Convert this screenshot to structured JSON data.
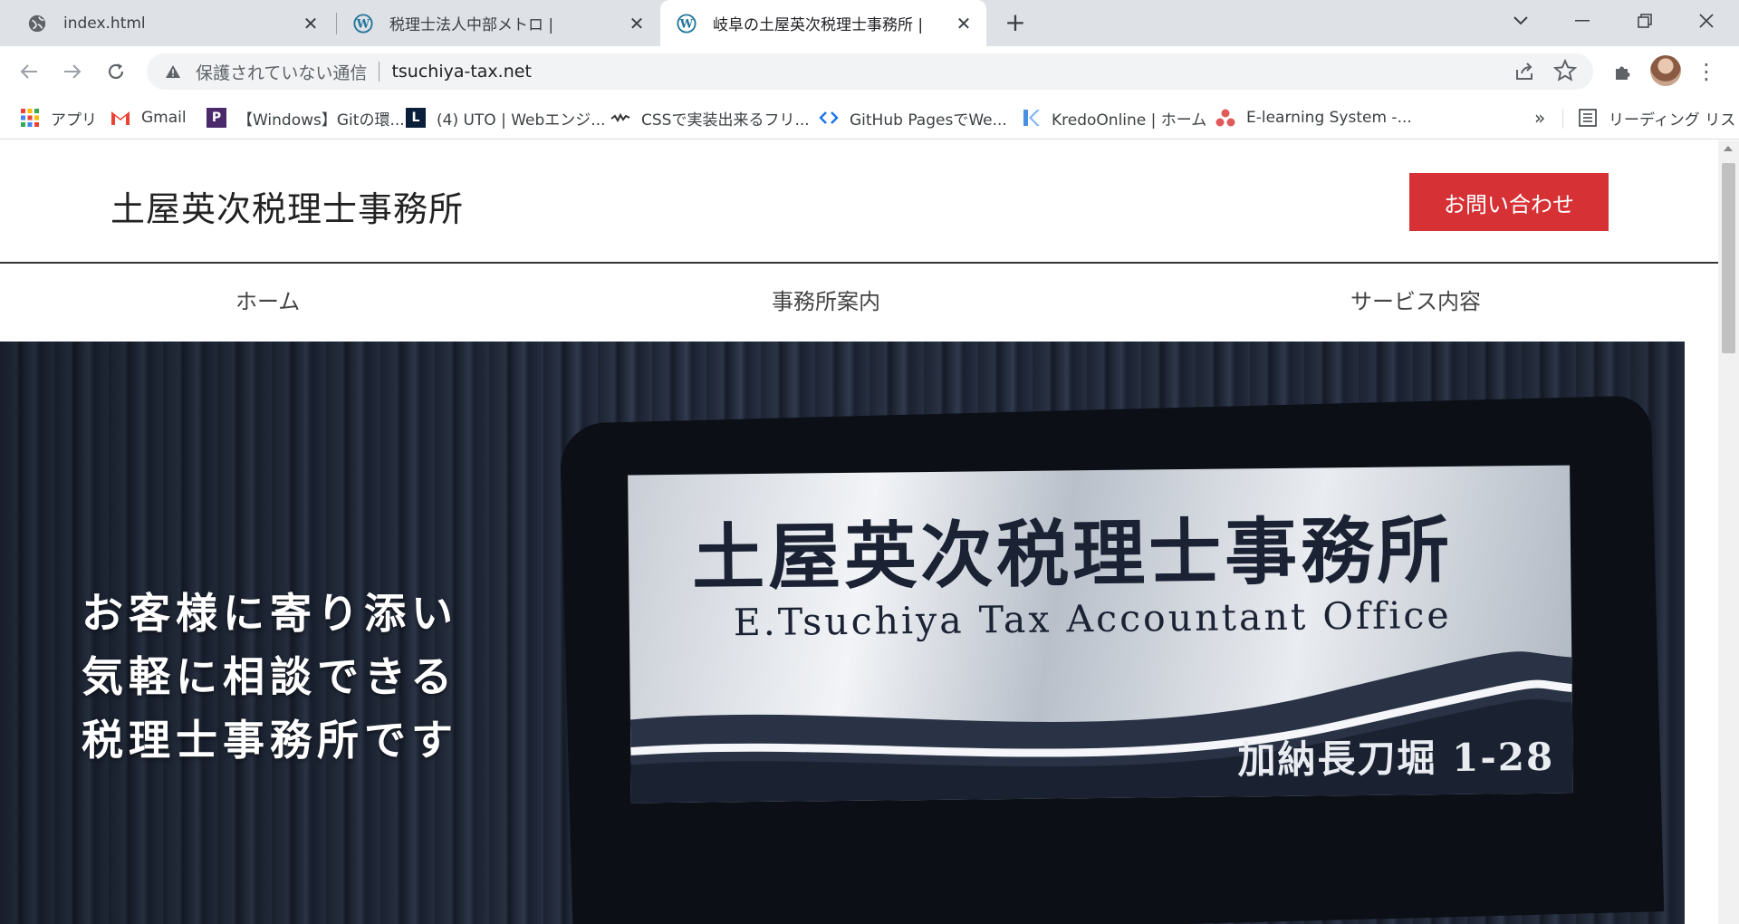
{
  "browser": {
    "tabs": [
      {
        "title": "index.html",
        "icon": "globe-icon"
      },
      {
        "title": "税理士法人中部メトロ |",
        "icon": "wordpress-icon"
      },
      {
        "title": "岐阜の土屋英次税理士事務所 |",
        "icon": "wordpress-icon",
        "active": true
      }
    ],
    "address": {
      "security_label": "保護されていない通信",
      "url": "tsuchiya-tax.net"
    },
    "bookmarks": [
      {
        "label": "アプリ",
        "icon": "apps-grid-icon"
      },
      {
        "label": "Gmail",
        "icon": "gmail-icon"
      },
      {
        "label": "【Windows】Gitの環...",
        "icon": "bookmark-p-icon"
      },
      {
        "label": "(4) UTO | Webエンジ...",
        "icon": "bookmark-l-icon"
      },
      {
        "label": "CSSで実装出来るフリ...",
        "icon": "bookmark-wave-icon"
      },
      {
        "label": "GitHub PagesでWe...",
        "icon": "code-icon"
      },
      {
        "label": "KredoOnline | ホーム",
        "icon": "kredo-icon"
      },
      {
        "label": "E-learning System -...",
        "icon": "elearning-icon"
      }
    ],
    "reading_list_label": "リーディング リスト"
  },
  "site": {
    "title": "土屋英次税理士事務所",
    "contact_button": "お問い合わせ",
    "nav": [
      "ホーム",
      "事務所案内",
      "サービス内容"
    ]
  },
  "hero": {
    "copy": [
      "お客様に寄り添い",
      "気軽に相談できる",
      "税理士事務所です"
    ],
    "sign_jp": "土屋英次税理士事務所",
    "sign_en": "E.Tsuchiya Tax Accountant Office",
    "sign_address": "加納長刀堀 1-28"
  },
  "colors": {
    "accent": "#d63236",
    "tabstrip": "#dee1e6"
  }
}
